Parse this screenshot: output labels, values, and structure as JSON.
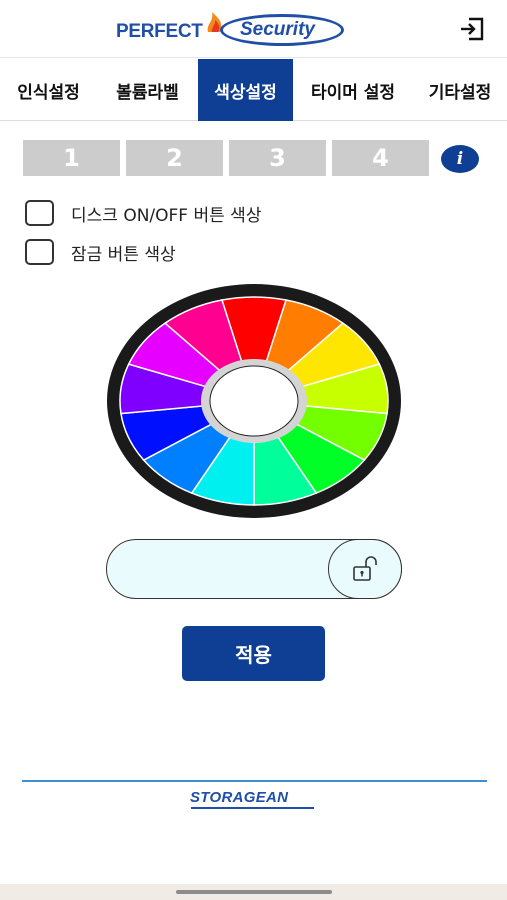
{
  "header": {
    "logo_perfect": "PERFECT",
    "logo_security": "Security",
    "logout_icon": "logout-icon"
  },
  "tabs": [
    {
      "label": "인식설정",
      "active": false
    },
    {
      "label": "볼륨라벨",
      "active": false
    },
    {
      "label": "색상설정",
      "active": true
    },
    {
      "label": "타이머 설정",
      "active": false
    },
    {
      "label": "기타설정",
      "active": false
    }
  ],
  "steps": [
    "1",
    "2",
    "3",
    "4"
  ],
  "info_label": "i",
  "options": {
    "disk_color_label": "디스크 ON/OFF 버튼 색상",
    "lock_color_label": "잠금 버튼 색상"
  },
  "color_wheel": {
    "colors": [
      "#ff0000",
      "#ff7d00",
      "#ffe600",
      "#c8ff00",
      "#73ff00",
      "#00ff26",
      "#00ff9b",
      "#00f0f0",
      "#0080ff",
      "#0010ff",
      "#8000ff",
      "#e600ff",
      "#ff0090"
    ],
    "rim_color": "#1a1a1a",
    "inner_ring_color": "#d4d4d4",
    "center_color": "#ffffff"
  },
  "preview": {
    "fill_color": "#e9fbfd",
    "icon": "unlock-icon"
  },
  "apply_label": "적용",
  "footer": {
    "logo_text": "STORAGEAN",
    "line_color": "#3f8fd6"
  },
  "accent_color": "#0e3f94"
}
